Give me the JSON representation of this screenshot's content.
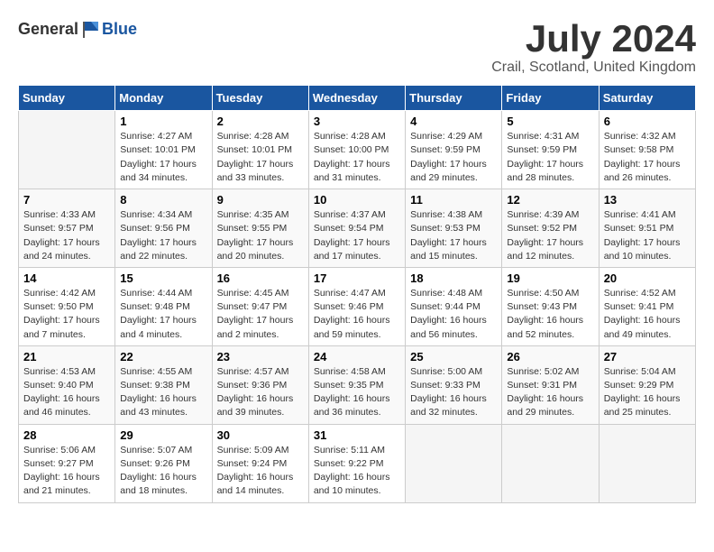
{
  "header": {
    "logo_general": "General",
    "logo_blue": "Blue",
    "month_year": "July 2024",
    "location": "Crail, Scotland, United Kingdom"
  },
  "days_of_week": [
    "Sunday",
    "Monday",
    "Tuesday",
    "Wednesday",
    "Thursday",
    "Friday",
    "Saturday"
  ],
  "weeks": [
    [
      {
        "day": "",
        "info": ""
      },
      {
        "day": "1",
        "info": "Sunrise: 4:27 AM\nSunset: 10:01 PM\nDaylight: 17 hours\nand 34 minutes."
      },
      {
        "day": "2",
        "info": "Sunrise: 4:28 AM\nSunset: 10:01 PM\nDaylight: 17 hours\nand 33 minutes."
      },
      {
        "day": "3",
        "info": "Sunrise: 4:28 AM\nSunset: 10:00 PM\nDaylight: 17 hours\nand 31 minutes."
      },
      {
        "day": "4",
        "info": "Sunrise: 4:29 AM\nSunset: 9:59 PM\nDaylight: 17 hours\nand 29 minutes."
      },
      {
        "day": "5",
        "info": "Sunrise: 4:31 AM\nSunset: 9:59 PM\nDaylight: 17 hours\nand 28 minutes."
      },
      {
        "day": "6",
        "info": "Sunrise: 4:32 AM\nSunset: 9:58 PM\nDaylight: 17 hours\nand 26 minutes."
      }
    ],
    [
      {
        "day": "7",
        "info": "Sunrise: 4:33 AM\nSunset: 9:57 PM\nDaylight: 17 hours\nand 24 minutes."
      },
      {
        "day": "8",
        "info": "Sunrise: 4:34 AM\nSunset: 9:56 PM\nDaylight: 17 hours\nand 22 minutes."
      },
      {
        "day": "9",
        "info": "Sunrise: 4:35 AM\nSunset: 9:55 PM\nDaylight: 17 hours\nand 20 minutes."
      },
      {
        "day": "10",
        "info": "Sunrise: 4:37 AM\nSunset: 9:54 PM\nDaylight: 17 hours\nand 17 minutes."
      },
      {
        "day": "11",
        "info": "Sunrise: 4:38 AM\nSunset: 9:53 PM\nDaylight: 17 hours\nand 15 minutes."
      },
      {
        "day": "12",
        "info": "Sunrise: 4:39 AM\nSunset: 9:52 PM\nDaylight: 17 hours\nand 12 minutes."
      },
      {
        "day": "13",
        "info": "Sunrise: 4:41 AM\nSunset: 9:51 PM\nDaylight: 17 hours\nand 10 minutes."
      }
    ],
    [
      {
        "day": "14",
        "info": "Sunrise: 4:42 AM\nSunset: 9:50 PM\nDaylight: 17 hours\nand 7 minutes."
      },
      {
        "day": "15",
        "info": "Sunrise: 4:44 AM\nSunset: 9:48 PM\nDaylight: 17 hours\nand 4 minutes."
      },
      {
        "day": "16",
        "info": "Sunrise: 4:45 AM\nSunset: 9:47 PM\nDaylight: 17 hours\nand 2 minutes."
      },
      {
        "day": "17",
        "info": "Sunrise: 4:47 AM\nSunset: 9:46 PM\nDaylight: 16 hours\nand 59 minutes."
      },
      {
        "day": "18",
        "info": "Sunrise: 4:48 AM\nSunset: 9:44 PM\nDaylight: 16 hours\nand 56 minutes."
      },
      {
        "day": "19",
        "info": "Sunrise: 4:50 AM\nSunset: 9:43 PM\nDaylight: 16 hours\nand 52 minutes."
      },
      {
        "day": "20",
        "info": "Sunrise: 4:52 AM\nSunset: 9:41 PM\nDaylight: 16 hours\nand 49 minutes."
      }
    ],
    [
      {
        "day": "21",
        "info": "Sunrise: 4:53 AM\nSunset: 9:40 PM\nDaylight: 16 hours\nand 46 minutes."
      },
      {
        "day": "22",
        "info": "Sunrise: 4:55 AM\nSunset: 9:38 PM\nDaylight: 16 hours\nand 43 minutes."
      },
      {
        "day": "23",
        "info": "Sunrise: 4:57 AM\nSunset: 9:36 PM\nDaylight: 16 hours\nand 39 minutes."
      },
      {
        "day": "24",
        "info": "Sunrise: 4:58 AM\nSunset: 9:35 PM\nDaylight: 16 hours\nand 36 minutes."
      },
      {
        "day": "25",
        "info": "Sunrise: 5:00 AM\nSunset: 9:33 PM\nDaylight: 16 hours\nand 32 minutes."
      },
      {
        "day": "26",
        "info": "Sunrise: 5:02 AM\nSunset: 9:31 PM\nDaylight: 16 hours\nand 29 minutes."
      },
      {
        "day": "27",
        "info": "Sunrise: 5:04 AM\nSunset: 9:29 PM\nDaylight: 16 hours\nand 25 minutes."
      }
    ],
    [
      {
        "day": "28",
        "info": "Sunrise: 5:06 AM\nSunset: 9:27 PM\nDaylight: 16 hours\nand 21 minutes."
      },
      {
        "day": "29",
        "info": "Sunrise: 5:07 AM\nSunset: 9:26 PM\nDaylight: 16 hours\nand 18 minutes."
      },
      {
        "day": "30",
        "info": "Sunrise: 5:09 AM\nSunset: 9:24 PM\nDaylight: 16 hours\nand 14 minutes."
      },
      {
        "day": "31",
        "info": "Sunrise: 5:11 AM\nSunset: 9:22 PM\nDaylight: 16 hours\nand 10 minutes."
      },
      {
        "day": "",
        "info": ""
      },
      {
        "day": "",
        "info": ""
      },
      {
        "day": "",
        "info": ""
      }
    ]
  ]
}
